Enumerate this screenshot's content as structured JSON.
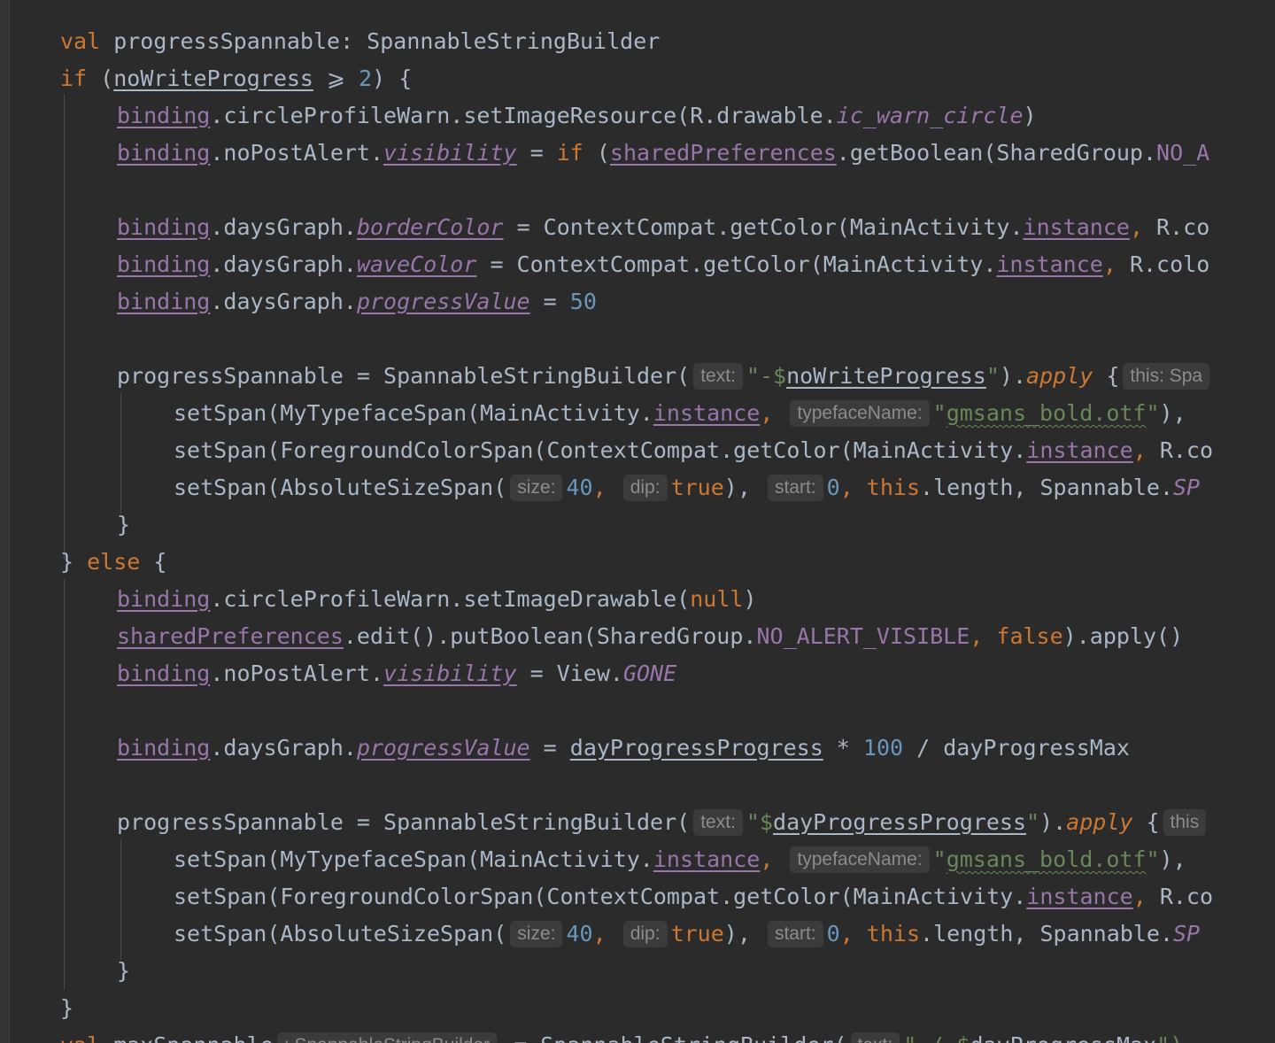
{
  "code": {
    "lines": [
      [
        "val",
        " progressSpannable: SpannableStringBuilder"
      ],
      [
        "if",
        " (",
        "noWriteProgress",
        " ⩾ ",
        "2",
        ") {"
      ],
      [
        "binding",
        ".circleProfileWarn.setImageResource(R.drawable.",
        "ic_warn_circle",
        ")"
      ],
      [
        "binding",
        ".noPostAlert.",
        "visibility",
        " = ",
        "if",
        " (",
        "sharedPreferences",
        ".getBoolean(SharedGroup.",
        "NO_A"
      ],
      [
        "binding",
        ".daysGraph.",
        "borderColor",
        " = ContextCompat.getColor(MainActivity.",
        "instance",
        ", ",
        "R.co"
      ],
      [
        "binding",
        ".daysGraph.",
        "waveColor",
        " = ContextCompat.getColor(MainActivity.",
        "instance",
        ", ",
        "R.colo"
      ],
      [
        "binding",
        ".daysGraph.",
        "progressValue",
        " = ",
        "50"
      ],
      [
        "progressSpannable = SpannableStringBuilder(",
        "text:",
        "\"-$",
        "noWriteProgress",
        "\"",
        ").",
        "apply",
        " {",
        "this: Spa"
      ],
      [
        "setSpan(MyTypefaceSpan(MainActivity.",
        "instance",
        ", ",
        "typefaceName:",
        "\"",
        "gmsans_bold.otf",
        "\"",
        "),"
      ],
      [
        "setSpan(ForegroundColorSpan(ContextCompat.getColor(MainActivity.",
        "instance",
        ", ",
        "R.co"
      ],
      [
        "setSpan(AbsoluteSizeSpan(",
        "size:",
        "40",
        ", ",
        "dip:",
        "true",
        "), ",
        "start:",
        "0",
        ", ",
        "this",
        ".length, Spannable.",
        "SP"
      ],
      [
        "}"
      ],
      [
        "} ",
        "else",
        " {"
      ],
      [
        "binding",
        ".circleProfileWarn.setImageDrawable(",
        "null",
        ")"
      ],
      [
        "sharedPreferences",
        ".edit().putBoolean(SharedGroup.",
        "NO_ALERT_VISIBLE",
        ", ",
        "false",
        ").apply()"
      ],
      [
        "binding",
        ".noPostAlert.",
        "visibility",
        " = View.",
        "GONE"
      ],
      [
        "binding",
        ".daysGraph.",
        "progressValue",
        " = ",
        "dayProgressProgress",
        " * ",
        "100",
        " / dayProgressMax"
      ],
      [
        "progressSpannable = SpannableStringBuilder(",
        "text:",
        "\"$",
        "dayProgressProgress",
        "\"",
        ").",
        "apply",
        " {",
        "this"
      ],
      [
        "setSpan(MyTypefaceSpan(MainActivity.",
        "instance",
        ", ",
        "typefaceName:",
        "\"",
        "gmsans_bold.otf",
        "\"",
        "),"
      ],
      [
        "setSpan(ForegroundColorSpan(ContextCompat.getColor(MainActivity.",
        "instance",
        ", ",
        "R.co"
      ],
      [
        "setSpan(AbsoluteSizeSpan(",
        "size:",
        "40",
        ", ",
        "dip:",
        "true",
        "), ",
        "start:",
        "0",
        ", ",
        "this",
        ".length, Spannable.",
        "SP"
      ],
      [
        "}"
      ],
      [
        "}"
      ],
      [
        "val",
        " maxSpannable",
        ": SpannableStringBuilder",
        " = SpannableStringBuilder(",
        "text:",
        "\" / $",
        "dayProgressMax",
        "\")"
      ]
    ]
  },
  "colors": {
    "background": "#2b2b2b",
    "keyword": "#cc7832",
    "number": "#6897bb",
    "string": "#6a8759",
    "property": "#9876aa",
    "default_text": "#a9b7c6"
  }
}
